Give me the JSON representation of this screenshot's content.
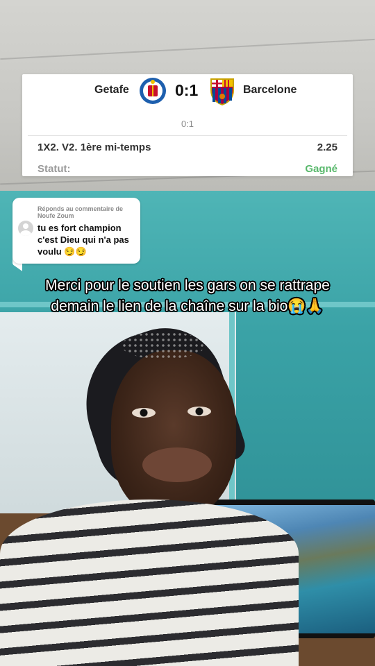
{
  "match_card": {
    "home_team": "Getafe",
    "score": "0:1",
    "away_team": "Barcelone",
    "half_score": "0:1",
    "bet_description": "1X2. V2. 1ère mi-temps",
    "odds": "2.25",
    "status_label": "Statut:",
    "status_value": "Gagné",
    "status_color": "#58b86b"
  },
  "reply": {
    "header": "Réponds au commentaire de Noufe Zoum",
    "comment": "tu es fort champion c'est Dieu qui n'a pas voulu 😏😏"
  },
  "caption": {
    "text": "Merci pour le soutien les gars on se rattrape demain le lien de la chaîne sur la bio😭🙏"
  },
  "icons": {
    "home_crest": "getafe-crest-icon",
    "away_crest": "barcelona-crest-icon",
    "avatar": "default-avatar-icon"
  }
}
